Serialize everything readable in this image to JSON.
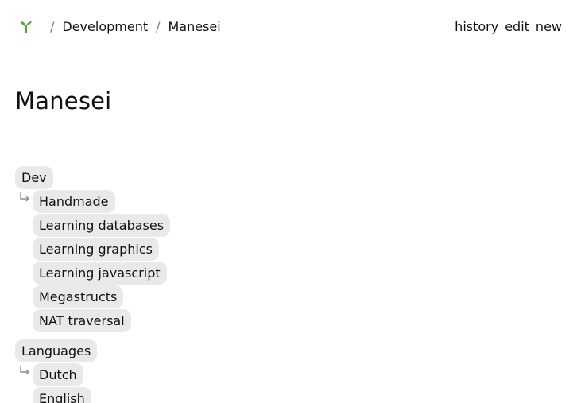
{
  "breadcrumb": {
    "home_icon": "sprout-icon",
    "separator": "/",
    "items": [
      "Development",
      "Manesei"
    ]
  },
  "actions": [
    "history",
    "edit",
    "new"
  ],
  "page_title": "Manesei",
  "groups": [
    {
      "label": "Dev",
      "children": [
        "Handmade",
        "Learning databases",
        "Learning graphics",
        "Learning javascript",
        "Megastructs",
        "NAT traversal"
      ]
    },
    {
      "label": "Languages",
      "children": [
        "Dutch",
        "English"
      ]
    }
  ],
  "colors": {
    "tag_bg": "#e9e9ec",
    "sprout": "#5aa23a",
    "hook": "#8a8a8a"
  }
}
